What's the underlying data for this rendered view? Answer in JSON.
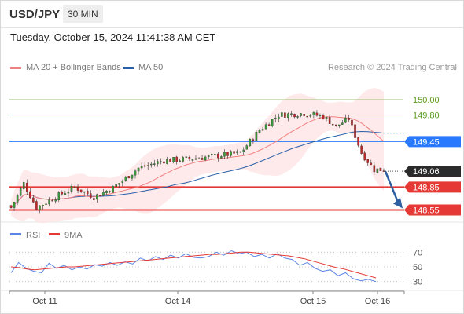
{
  "header": {
    "symbol": "USD/JPY",
    "timeframe": "30 MIN",
    "datetime": "Tuesday, October 15, 2024 11:41:38 AM CET",
    "credit": "Research © 2024 Trading Central"
  },
  "legend": [
    {
      "label": "MA 20 + Bollinger Bands",
      "color": "#f08080"
    },
    {
      "label": "MA 50",
      "color": "#2a5fa8"
    }
  ],
  "chart_data": [
    {
      "type": "candlestick",
      "title": "",
      "ylim": [
        148.4,
        150.3
      ],
      "x_tick_labels": [
        "Oct 11",
        "Oct 14",
        "Oct 15",
        "Oct 16"
      ],
      "candle_count": 118,
      "close_path": [
        [
          0,
          148.58
        ],
        [
          4,
          148.9
        ],
        [
          8,
          148.58
        ],
        [
          14,
          148.72
        ],
        [
          20,
          148.85
        ],
        [
          26,
          148.72
        ],
        [
          32,
          148.84
        ],
        [
          40,
          149.1
        ],
        [
          48,
          149.2
        ],
        [
          56,
          149.22
        ],
        [
          62,
          149.25
        ],
        [
          72,
          149.3
        ],
        [
          78,
          149.6
        ],
        [
          84,
          149.8
        ],
        [
          92,
          149.82
        ],
        [
          98,
          149.78
        ],
        [
          102,
          149.65
        ],
        [
          106,
          149.75
        ],
        [
          110,
          149.3
        ],
        [
          114,
          149.08
        ]
      ],
      "series": [
        {
          "name": "MA 20",
          "color": "#f08080"
        },
        {
          "name": "MA 50",
          "color": "#2a5fa8"
        }
      ],
      "levels": [
        {
          "value": "150.00",
          "kind": "target",
          "color": "#7cb342"
        },
        {
          "value": "149.80",
          "kind": "target",
          "color": "#7cb342"
        },
        {
          "value": "149.45",
          "kind": "pivot",
          "color": "#2979ff"
        },
        {
          "value": "149.06",
          "kind": "last",
          "color": "#2b2b2b"
        },
        {
          "value": "148.85",
          "kind": "support",
          "color": "#e53935"
        },
        {
          "value": "148.55",
          "kind": "support",
          "color": "#e53935"
        }
      ]
    },
    {
      "type": "line",
      "title": "",
      "legend": [
        {
          "label": "RSI",
          "color": "#5b86e5"
        },
        {
          "label": "9MA",
          "color": "#e53935"
        }
      ],
      "ylim": [
        20,
        80
      ],
      "y_tick_labels": [
        "70",
        "50",
        "30"
      ],
      "series": [
        {
          "name": "RSI",
          "color": "#5b86e5",
          "values": [
            42,
            56,
            48,
            44,
            42,
            55,
            48,
            52,
            46,
            50,
            47,
            53,
            51,
            56,
            52,
            57,
            54,
            62,
            58,
            64,
            60,
            66,
            62,
            68,
            63,
            62,
            64,
            70,
            66,
            72,
            68,
            70,
            64,
            67,
            62,
            68,
            62,
            60,
            52,
            56,
            48,
            44,
            46,
            38,
            42,
            34,
            31,
            33,
            30
          ]
        },
        {
          "name": "9MA",
          "color": "#e53935",
          "values": [
            50,
            49,
            47,
            46,
            47,
            48,
            49,
            50,
            50,
            51,
            52,
            53,
            54,
            55,
            56,
            57,
            58,
            59,
            60,
            61,
            62,
            63,
            64,
            65,
            66,
            67,
            67,
            68,
            69,
            70,
            70,
            69,
            68,
            67,
            66,
            65,
            63,
            61,
            58,
            55,
            52,
            49,
            47,
            44,
            41,
            38,
            35
          ]
        }
      ]
    }
  ]
}
